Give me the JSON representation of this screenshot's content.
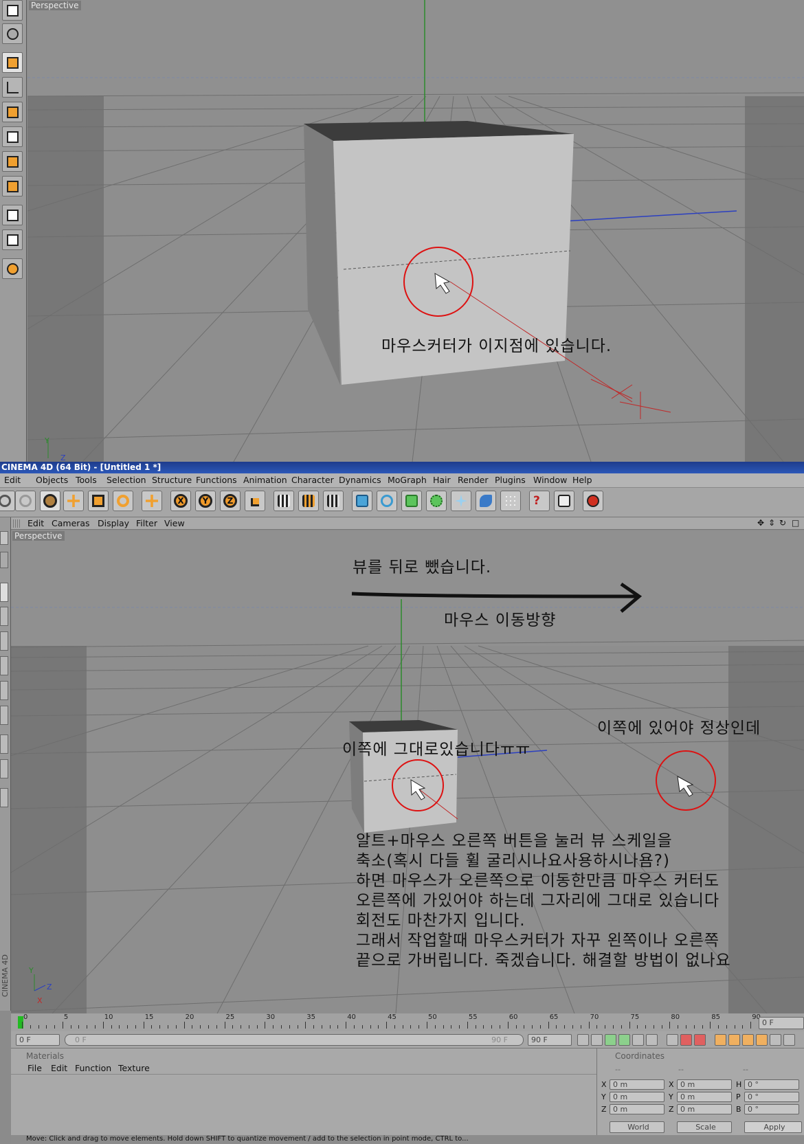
{
  "top_view": {
    "label": "Perspective",
    "annotation": "마우스커터가 이지점에 있습니다."
  },
  "window": {
    "title": "CINEMA 4D (64 Bit) - [Untitled 1 *]"
  },
  "menu": [
    "Edit",
    "Objects",
    "Tools",
    "Selection",
    "Structure",
    "Functions",
    "Animation",
    "Character",
    "Dynamics",
    "MoGraph",
    "Hair",
    "Render",
    "Plugins",
    "Window",
    "Help"
  ],
  "toolbar": {
    "axis_labels": [
      "X",
      "Y",
      "Z"
    ],
    "icons": [
      "undo-icon",
      "redo-icon",
      "live-select-icon",
      "move-icon",
      "scale-icon",
      "rotate-icon",
      "move-tool-icon",
      "x-axis-lock-icon",
      "y-axis-lock-icon",
      "z-axis-lock-icon",
      "world-coordinates-icon",
      "render-view-icon",
      "render-picture-viewer-icon",
      "render-settings-icon",
      "cube-icon",
      "spline-pen-icon",
      "nurbs-icon",
      "array-icon",
      "deformer-icon",
      "scene-icon",
      "particles-icon",
      "help-cursor-icon",
      "script-manager-icon",
      "layout-icon"
    ]
  },
  "view_menu": [
    "Edit",
    "Cameras",
    "Display",
    "Filter",
    "View"
  ],
  "bottom_view": {
    "label": "Perspective",
    "annotations": {
      "zoom_out": "뷰를 뒤로 뺐습니다.",
      "mouse_direction": "마우스 이동방향",
      "should_be_here": "이쪽에 있어야 정상인데",
      "stays_here": "이쪽에 그대로있습니다ㅠㅠ",
      "explanation": "알트+마우스 오른쪽 버튼을 눌러 뷰 스케일을\n축소(혹시 다들 휠 굴리시나요사용하시나욤?)\n하면 마우스가 오른쪽으로 이동한만큼 마우스 커터도\n오른쪽에 가있어야 하는데 그자리에 그대로 있습니다\n회전도 마찬가지 입니다.\n그래서 작업할때 마우스커터가 자꾸 왼쪽이나 오른쪽\n끝으로 가버립니다. 죽겠습니다. 해결할 방법이 없나요"
    }
  },
  "timeline": {
    "ticks": [
      "0",
      "5",
      "10",
      "15",
      "20",
      "25",
      "30",
      "35",
      "40",
      "45",
      "50",
      "55",
      "60",
      "65",
      "70",
      "75",
      "80",
      "85",
      "90"
    ],
    "current_frame": "0 F",
    "start_field": "0 F",
    "slider_left": "0 F",
    "slider_right": "90 F",
    "end_field": "90 F"
  },
  "materials": {
    "title": "Materials",
    "menu": [
      "File",
      "Edit",
      "Function",
      "Texture"
    ]
  },
  "coordinates": {
    "title": "Coordinates",
    "dashes": [
      "--",
      "--",
      "--"
    ],
    "rows": [
      {
        "a": "X",
        "av": "0 m",
        "b": "X",
        "bv": "0 m",
        "c": "H",
        "cv": "0 °"
      },
      {
        "a": "Y",
        "av": "0 m",
        "b": "Y",
        "bv": "0 m",
        "c": "P",
        "cv": "0 °"
      },
      {
        "a": "Z",
        "av": "0 m",
        "b": "Z",
        "bv": "0 m",
        "c": "B",
        "cv": "0 °"
      }
    ],
    "world": "World",
    "scale": "Scale",
    "apply": "Apply"
  },
  "side_brand": "CINEMA 4D",
  "status": "Move: Click and drag to move elements. Hold down SHIFT to quantize movement / add to the selection in point mode, CTRL to..."
}
